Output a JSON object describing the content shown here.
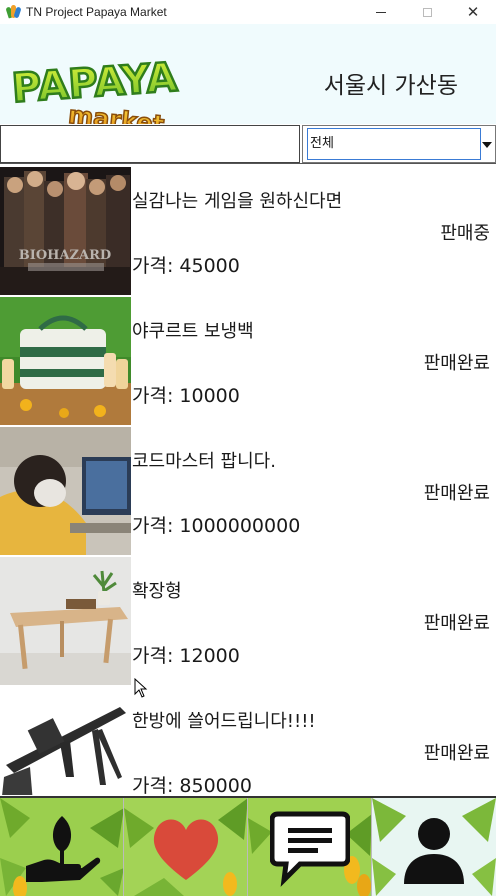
{
  "window": {
    "title": "TN Project Papaya Market"
  },
  "header": {
    "logo_text_top": "PAPAYA",
    "logo_text_bottom": "market",
    "location": "서울시 가산동"
  },
  "search": {
    "value": "",
    "placeholder": "",
    "category": "전체"
  },
  "items": [
    {
      "title": "실감나는 게임을 원하신다면",
      "status": "판매중",
      "price": "가격: 45000",
      "thumb_text": "BIOHAZARD"
    },
    {
      "title": "야쿠르트 보냉백",
      "status": "판매완료",
      "price": "가격: 10000"
    },
    {
      "title": "코드마스터 팝니다.",
      "status": "판매완료",
      "price": "가격: 1000000000"
    },
    {
      "title": "확장형",
      "status": "판매완료",
      "price": "가격: 12000"
    },
    {
      "title": "한방에 쓸어드립니다!!!!",
      "status": "판매완료",
      "price": "가격: 850000"
    }
  ],
  "nav": [
    {
      "icon": "sprout-hand-icon"
    },
    {
      "icon": "heart-icon"
    },
    {
      "icon": "chat-icon"
    },
    {
      "icon": "person-icon"
    }
  ]
}
